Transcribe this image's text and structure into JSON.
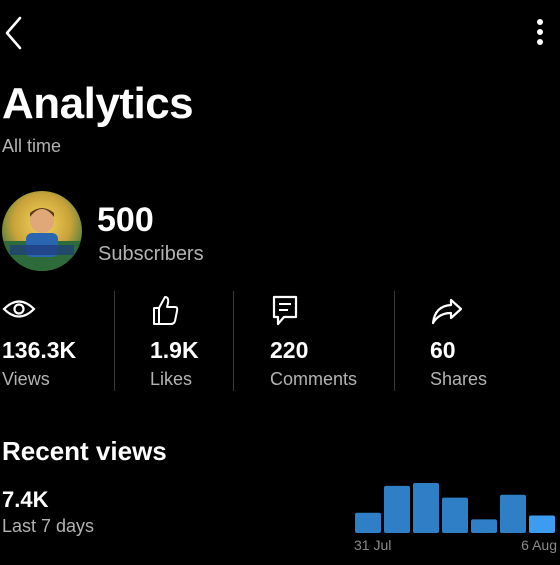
{
  "header": {
    "title": "Analytics",
    "subtitle": "All time"
  },
  "channel": {
    "subscriber_count": "500",
    "subscriber_label": "Subscribers"
  },
  "stats": [
    {
      "icon": "eye-icon",
      "value": "136.3K",
      "label": "Views"
    },
    {
      "icon": "thumbs-up-icon",
      "value": "1.9K",
      "label": "Likes"
    },
    {
      "icon": "comment-icon",
      "value": "220",
      "label": "Comments"
    },
    {
      "icon": "share-icon",
      "value": "60",
      "label": "Shares"
    }
  ],
  "recent_views": {
    "title": "Recent views",
    "value": "7.4K",
    "period": "Last 7 days"
  },
  "colors": {
    "accent_bar": "#2f7fc6",
    "highlight_bar": "#3b9cf0",
    "muted_text": "#b3b3b3"
  },
  "chart_data": {
    "type": "bar",
    "categories": [
      "31 Jul",
      "1 Aug",
      "2 Aug",
      "3 Aug",
      "4 Aug",
      "5 Aug",
      "6 Aug"
    ],
    "values": [
      0.43,
      1.0,
      1.06,
      0.75,
      0.29,
      0.81,
      0.37
    ],
    "x_tick_labels": [
      "31 Jul",
      "6 Aug"
    ],
    "grid": false
  }
}
